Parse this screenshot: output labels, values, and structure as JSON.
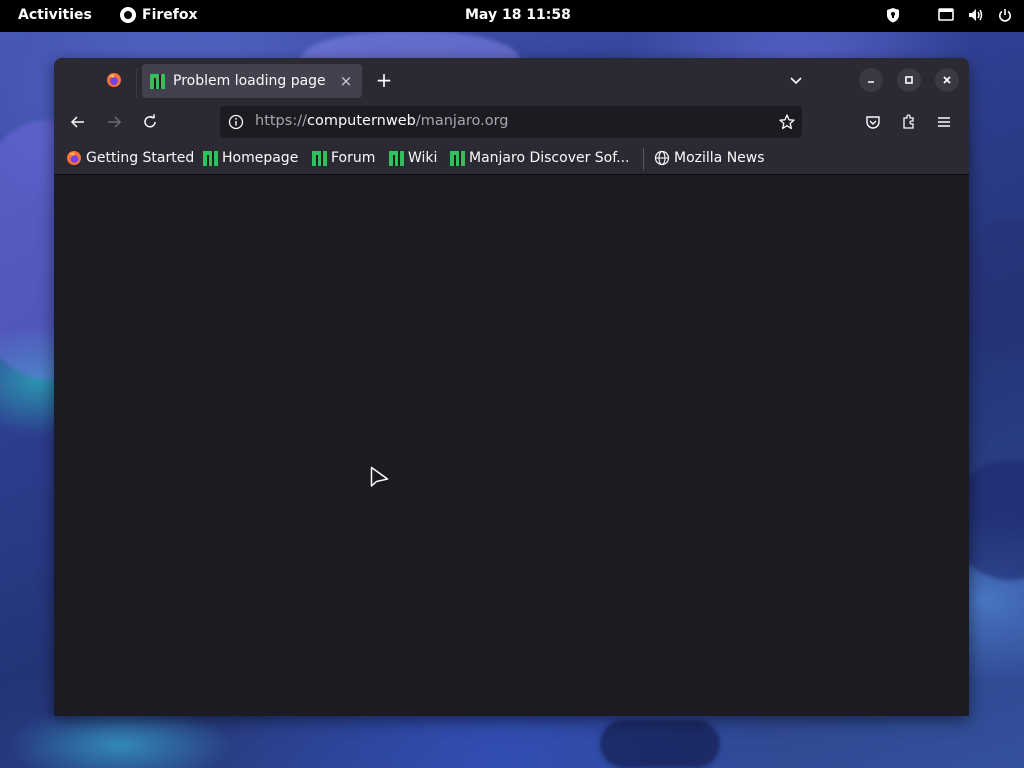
{
  "topbar": {
    "activities": "Activities",
    "app_name": "Firefox",
    "clock": "May 18  11:58"
  },
  "browser": {
    "tab": {
      "title": "Problem loading page",
      "close": "×"
    },
    "newtab": "+",
    "urlbar": {
      "scheme": "https://",
      "host": "computernweb",
      "path": "/manjaro.org"
    },
    "bookmarks": [
      {
        "label": "Getting Started",
        "icon": "firefox-icon"
      },
      {
        "label": "Homepage",
        "icon": "manjaro-icon"
      },
      {
        "label": "Forum",
        "icon": "manjaro-icon"
      },
      {
        "label": "Wiki",
        "icon": "manjaro-icon"
      },
      {
        "label": "Manjaro Discover Sof...",
        "icon": "manjaro-icon"
      },
      {
        "label": "Mozilla News",
        "icon": "globe-icon"
      }
    ]
  },
  "colors": {
    "accent": "#35bf5c",
    "window_bg": "#1c1b22",
    "toolbar_bg": "#2b2a33",
    "tab_bg": "#42414d"
  }
}
